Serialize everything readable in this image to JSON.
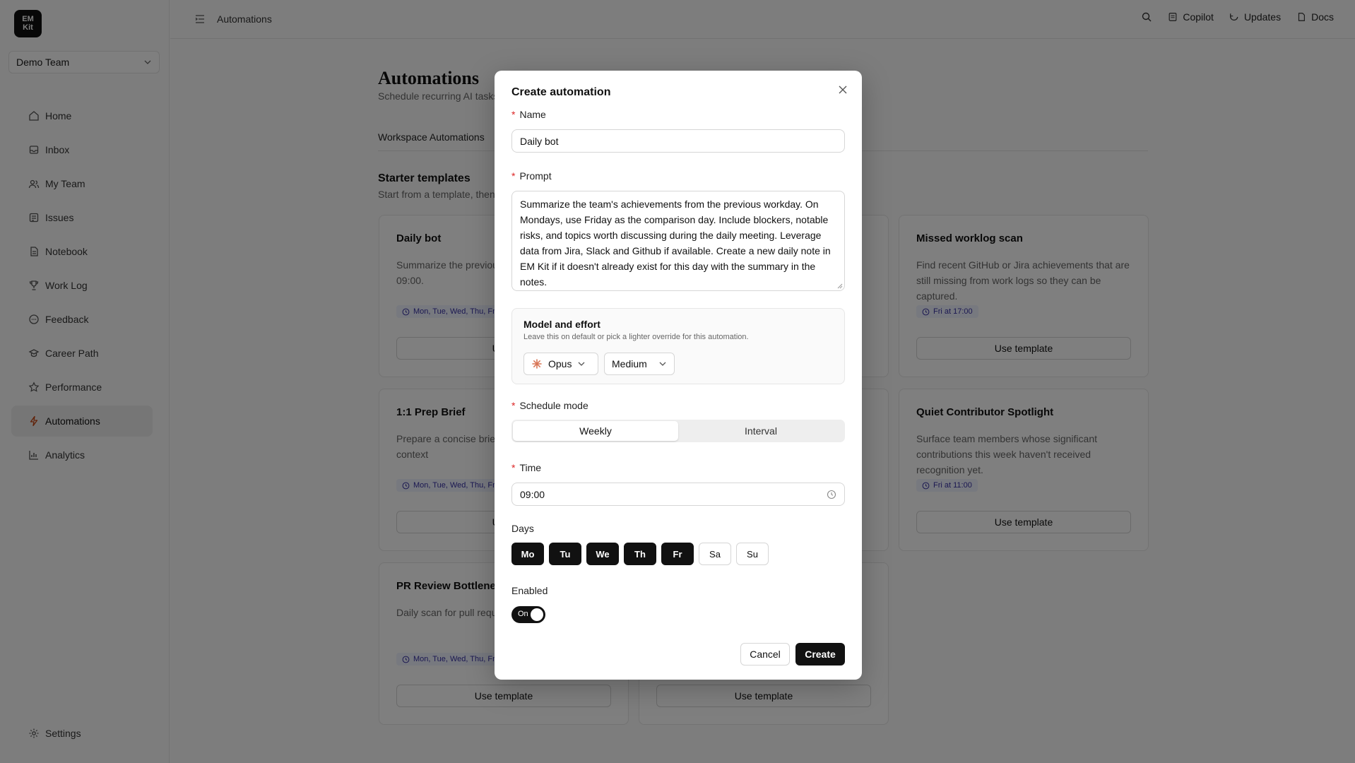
{
  "brand": {
    "logo_line1": "EM",
    "logo_line2": "Kit"
  },
  "team_select": {
    "value": "Demo Team"
  },
  "sidebar": {
    "items": [
      {
        "label": "Home",
        "icon": "home-icon"
      },
      {
        "label": "Inbox",
        "icon": "inbox-icon"
      },
      {
        "label": "My Team",
        "icon": "users-icon"
      },
      {
        "label": "Issues",
        "icon": "issues-icon"
      },
      {
        "label": "Notebook",
        "icon": "notebook-icon"
      },
      {
        "label": "Work Log",
        "icon": "trophy-icon"
      },
      {
        "label": "Feedback",
        "icon": "feedback-icon"
      },
      {
        "label": "Career Path",
        "icon": "career-icon"
      },
      {
        "label": "Performance",
        "icon": "star-icon"
      },
      {
        "label": "Automations",
        "icon": "zap-icon",
        "active": true
      },
      {
        "label": "Analytics",
        "icon": "chart-icon"
      }
    ],
    "settings_label": "Settings"
  },
  "topbar": {
    "breadcrumb": "Automations",
    "copilot": "Copilot",
    "updates": "Updates",
    "docs": "Docs"
  },
  "page": {
    "title": "Automations",
    "subtitle": "Schedule recurring AI tasks f",
    "tab": "Workspace Automations",
    "section_title": "Starter templates",
    "section_subtitle": "Start from a template, then a"
  },
  "cards": [
    {
      "title": "Daily bot",
      "desc": "Summarize the previous weekends by only runni 09:00.",
      "badge": "Mon, Tue, Wed, Thu, Fr",
      "button": "Use t"
    },
    {
      "title": "Missed worklog scan",
      "desc": "Find recent GitHub or Jira achievements that are still missing from work logs so they can be captured.",
      "badge": "Fri at 17:00",
      "button": "Use template"
    },
    {
      "title": "1:1 Prep Brief",
      "desc": "Prepare a concise brief f gathering recent context",
      "badge": "Mon, Tue, Wed, Thu, Fr",
      "button": "Use t"
    },
    {
      "title": "Quiet Contributor Spotlight",
      "desc": "Surface team members whose significant contributions this week haven't received recognition yet.",
      "badge": "Fri at 11:00",
      "button": "Use template"
    },
    {
      "title": "PR Review Bottleneck",
      "desc": "Daily scan for pull reque that are stuck waiting fo",
      "badge": "Mon, Tue, Wed, Thu, Fr",
      "button": "Use template"
    },
    {
      "title": "",
      "desc": "",
      "badge": "",
      "button": "Use template"
    }
  ],
  "modal": {
    "title": "Create automation",
    "name_label": "Name",
    "name_value": "Daily bot",
    "prompt_label": "Prompt",
    "prompt_value": "Summarize the team's achievements from the previous workday. On Mondays, use Friday as the comparison day. Include blockers, notable risks, and topics worth discussing during the daily meeting. Leverage data from Jira, Slack and Github if available. Create a new daily note in EM Kit if it doesn't already exist for this day with the summary in the notes.",
    "model_title": "Model and effort",
    "model_sub": "Leave this on default or pick a lighter override for this automation.",
    "model_value": "Opus",
    "effort_value": "Medium",
    "schedule_label": "Schedule mode",
    "schedule_options": [
      "Weekly",
      "Interval"
    ],
    "schedule_selected": "Weekly",
    "time_label": "Time",
    "time_value": "09:00",
    "days_label": "Days",
    "days": [
      {
        "label": "Mo",
        "on": true
      },
      {
        "label": "Tu",
        "on": true
      },
      {
        "label": "We",
        "on": true
      },
      {
        "label": "Th",
        "on": true
      },
      {
        "label": "Fr",
        "on": true
      },
      {
        "label": "Sa",
        "on": false
      },
      {
        "label": "Su",
        "on": false
      }
    ],
    "enabled_label": "Enabled",
    "toggle_label": "On",
    "cancel": "Cancel",
    "create": "Create"
  },
  "colors": {
    "accent": "#111111",
    "required": "#dc2626",
    "active_icon": "#c2410c",
    "badge_bg": "#eef2ff"
  }
}
